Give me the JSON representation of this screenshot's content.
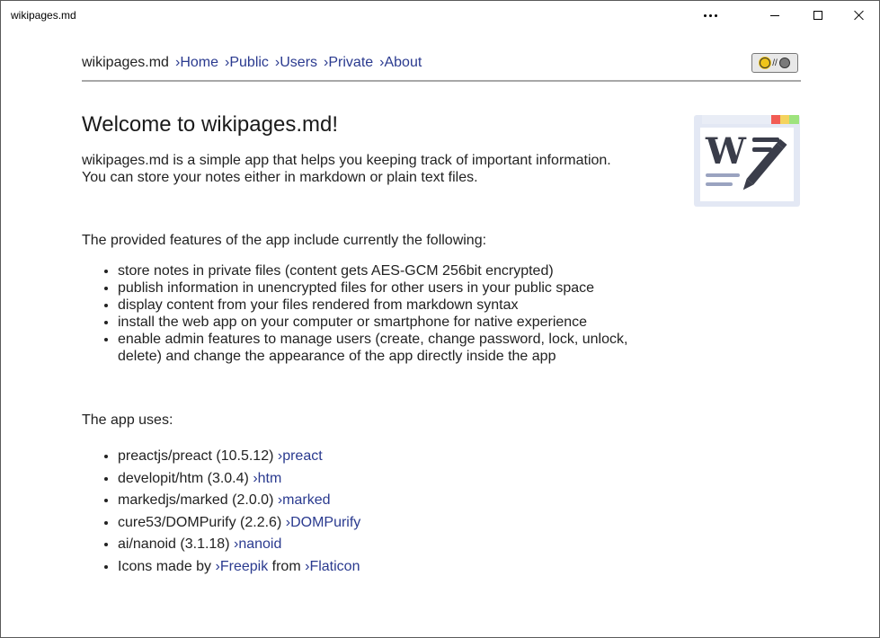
{
  "window": {
    "title": "wikipages.md"
  },
  "nav": {
    "brand": "wikipages.md",
    "links": [
      {
        "label": "›Home"
      },
      {
        "label": "›Public"
      },
      {
        "label": "›Users"
      },
      {
        "label": "›Private"
      },
      {
        "label": "›About"
      }
    ],
    "theme_separator": "//"
  },
  "main": {
    "heading": "Welcome to wikipages.md!",
    "intro_line1": "wikipages.md is a simple app that helps you keeping track of important information.",
    "intro_line2": "You can store your notes either in markdown or plain text files.",
    "features_title": "The provided features of the app include currently the following:",
    "features": [
      "store notes in private files (content gets AES-GCM 256bit encrypted)",
      "publish information in unencrypted files for other users in your public space",
      "display content from your files rendered from markdown syntax",
      "install the web app on your computer or smartphone for native experience",
      "enable admin features to manage users (create, change password, lock, unlock, delete) and change the appearance of the app directly inside the app"
    ],
    "uses_title": "The app uses:",
    "uses": [
      {
        "text": "preactjs/preact (10.5.12)",
        "link": "›preact"
      },
      {
        "text": "developit/htm (3.0.4)",
        "link": "›htm"
      },
      {
        "text": "markedjs/marked (2.0.0)",
        "link": "›marked"
      },
      {
        "text": "cure53/DOMPurify (2.2.6)",
        "link": "›DOMPurify"
      },
      {
        "text": "ai/nanoid (3.1.18)",
        "link": "›nanoid"
      }
    ],
    "credits": {
      "prefix": "Icons made by",
      "link1": "›Freepik",
      "middle": "from",
      "link2": "›Flaticon"
    }
  },
  "colors": {
    "link": "#2a3a8f",
    "logo_bg": "#e3e8f4",
    "logo_dark": "#3a3d4a",
    "dot_red": "#f25c54",
    "dot_yellow": "#f4d35e",
    "dot_green": "#9ee37d"
  }
}
